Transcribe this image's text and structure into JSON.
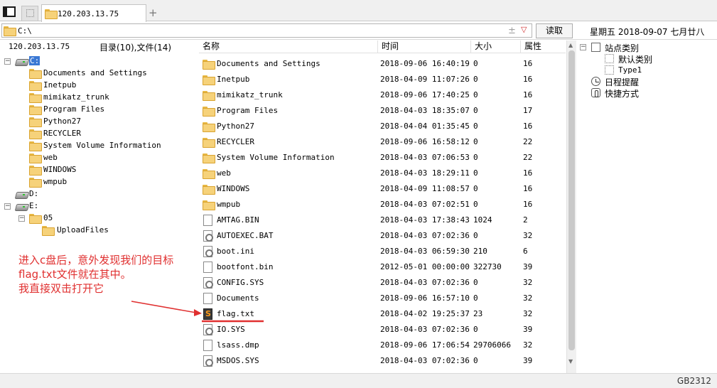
{
  "tab": {
    "title": "120.203.13.75",
    "add": "+"
  },
  "address": {
    "path": "C:\\",
    "star_glyph": "±",
    "dropdown_glyph": "▽",
    "read_label": "读取"
  },
  "date_text": "星期五 2018-09-07 七月廿八",
  "tree": {
    "host": "120.203.13.75",
    "count": "目录(10),文件(14)",
    "items": [
      {
        "label": "C:",
        "kind": "drive",
        "expander": "−",
        "selected": true
      },
      {
        "label": "Documents and Settings",
        "kind": "folder"
      },
      {
        "label": "Inetpub",
        "kind": "folder"
      },
      {
        "label": "mimikatz_trunk",
        "kind": "folder"
      },
      {
        "label": "Program Files",
        "kind": "folder"
      },
      {
        "label": "Python27",
        "kind": "folder"
      },
      {
        "label": "RECYCLER",
        "kind": "folder"
      },
      {
        "label": "System Volume Information",
        "kind": "folder"
      },
      {
        "label": "web",
        "kind": "folder"
      },
      {
        "label": "WINDOWS",
        "kind": "folder"
      },
      {
        "label": "wmpub",
        "kind": "folder"
      },
      {
        "label": "D:",
        "kind": "drive"
      },
      {
        "label": "E:",
        "kind": "drive",
        "expander": "−"
      },
      {
        "label": "05",
        "kind": "folder",
        "expander": "−"
      },
      {
        "label": "UploadFiles",
        "kind": "folder"
      }
    ]
  },
  "list": {
    "columns": {
      "name": "名称",
      "time": "时间",
      "size": "大小",
      "attr": "属性"
    },
    "rows": [
      {
        "name": "Documents and Settings",
        "time": "2018-09-06 16:40:19",
        "size": "0",
        "attr": "16",
        "icon": "folder"
      },
      {
        "name": "Inetpub",
        "time": "2018-04-09 11:07:26",
        "size": "0",
        "attr": "16",
        "icon": "folder"
      },
      {
        "name": "mimikatz_trunk",
        "time": "2018-09-06 17:40:25",
        "size": "0",
        "attr": "16",
        "icon": "folder"
      },
      {
        "name": "Program Files",
        "time": "2018-04-03 18:35:07",
        "size": "0",
        "attr": "17",
        "icon": "folder"
      },
      {
        "name": "Python27",
        "time": "2018-04-04 01:35:45",
        "size": "0",
        "attr": "16",
        "icon": "folder"
      },
      {
        "name": "RECYCLER",
        "time": "2018-09-06 16:58:12",
        "size": "0",
        "attr": "22",
        "icon": "folder"
      },
      {
        "name": "System Volume Information",
        "time": "2018-04-03 07:06:53",
        "size": "0",
        "attr": "22",
        "icon": "folder"
      },
      {
        "name": "web",
        "time": "2018-04-03 18:29:11",
        "size": "0",
        "attr": "16",
        "icon": "folder"
      },
      {
        "name": "WINDOWS",
        "time": "2018-04-09 11:08:57",
        "size": "0",
        "attr": "16",
        "icon": "folder"
      },
      {
        "name": "wmpub",
        "time": "2018-04-03 07:02:51",
        "size": "0",
        "attr": "16",
        "icon": "folder"
      },
      {
        "name": "AMTAG.BIN",
        "time": "2018-04-03 17:38:43",
        "size": "1024",
        "attr": "2",
        "icon": "file"
      },
      {
        "name": "AUTOEXEC.BAT",
        "time": "2018-04-03 07:02:36",
        "size": "0",
        "attr": "32",
        "icon": "gear"
      },
      {
        "name": "boot.ini",
        "time": "2018-04-03 06:59:30",
        "size": "210",
        "attr": "6",
        "icon": "gear"
      },
      {
        "name": "bootfont.bin",
        "time": "2012-05-01 00:00:00",
        "size": "322730",
        "attr": "39",
        "icon": "file"
      },
      {
        "name": "CONFIG.SYS",
        "time": "2018-04-03 07:02:36",
        "size": "0",
        "attr": "32",
        "icon": "gear"
      },
      {
        "name": "Documents",
        "time": "2018-09-06 16:57:10",
        "size": "0",
        "attr": "32",
        "icon": "file"
      },
      {
        "name": "flag.txt",
        "time": "2018-04-02 19:25:37",
        "size": "23",
        "attr": "32",
        "icon": "sublime"
      },
      {
        "name": "IO.SYS",
        "time": "2018-04-03 07:02:36",
        "size": "0",
        "attr": "39",
        "icon": "gear"
      },
      {
        "name": "lsass.dmp",
        "time": "2018-09-06 17:06:54",
        "size": "29706066",
        "attr": "32",
        "icon": "file"
      },
      {
        "name": "MSDOS.SYS",
        "time": "2018-04-03 07:02:36",
        "size": "0",
        "attr": "39",
        "icon": "gear"
      }
    ]
  },
  "right_panel": {
    "site_category": "站点类别",
    "default_category": "默认类别",
    "type1": "Type1",
    "schedule": "日程提醒",
    "shortcuts": "快捷方式"
  },
  "annotation": {
    "line1": "进入c盘后，意外发现我们的目标",
    "line2": "flag.txt文件就在其中。",
    "line3": "我直接双击打开它",
    "color": "#e03030"
  },
  "status": {
    "encoding": "GB2312"
  }
}
